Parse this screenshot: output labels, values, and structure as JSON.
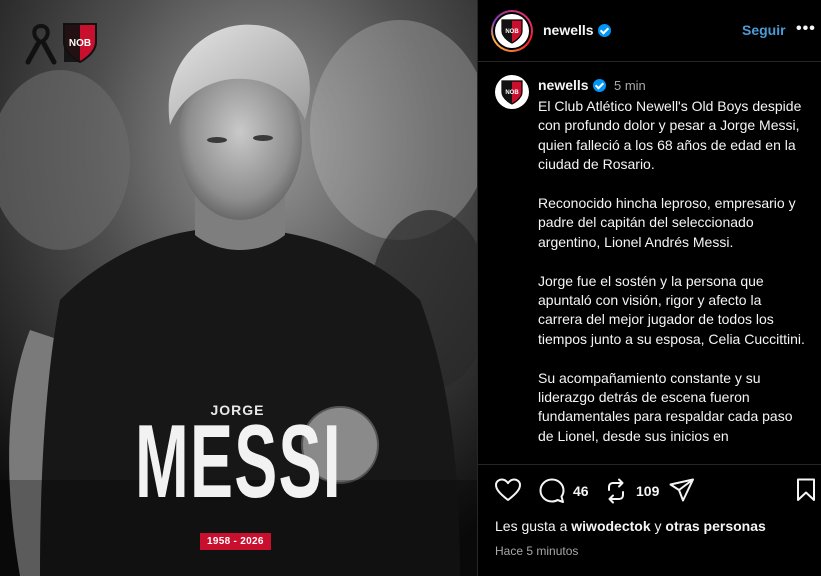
{
  "post_image": {
    "first_name": "JORGE",
    "last_name": "MESSI",
    "dates": "1958 - 2026",
    "crest_label": "NOB"
  },
  "header": {
    "username": "newells",
    "follow_label": "Seguir",
    "more_label": "•••"
  },
  "caption": {
    "username": "newells",
    "time": "5 min",
    "paragraphs": [
      "El Club Atlético Newell's Old Boys despide con profundo dolor y pesar a Jorge Messi, quien falleció a los 68 años de edad en la ciudad de Rosario.",
      "Reconocido hincha leproso, empresario y padre del capitán del seleccionado argentino, Lionel Andrés Messi.",
      "Jorge fue el sostén y la persona que apuntaló con visión, rigor y afecto la carrera del mejor jugador de todos los tiempos junto a su esposa, Celia Cuccittini.",
      "Su acompañamiento constante y su liderazgo detrás de escena fueron fundamentales para respaldar cada paso de Lionel, desde sus inicios en"
    ]
  },
  "actions": {
    "comments_count": "46",
    "reposts_count": "109"
  },
  "likes": {
    "prefix": "Les gusta a",
    "user": "wiwodectok",
    "joiner": "y",
    "others": "otras personas"
  },
  "timestamp": "Hace 5 minutos",
  "colors": {
    "brand_red": "#c8102e",
    "link_blue": "#0095f6",
    "follow_blue": "#4c9bd6"
  }
}
